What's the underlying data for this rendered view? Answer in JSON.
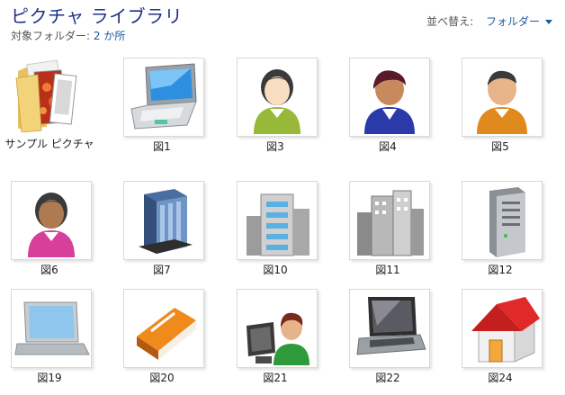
{
  "header": {
    "title": "ピクチャ ライブラリ",
    "target_label": "対象フォルダー:",
    "target_link": "2 か所",
    "sort_label": "並べ替え:",
    "sort_value": "フォルダー"
  },
  "items": [
    {
      "label": "サンプル ピクチャ",
      "icon": "folder-icon"
    },
    {
      "label": "図1",
      "icon": "laptop-icon"
    },
    {
      "label": "図3",
      "icon": "user-woman-icon"
    },
    {
      "label": "図4",
      "icon": "user-man-icon"
    },
    {
      "label": "図5",
      "icon": "user-orange-icon"
    },
    {
      "label": "図6",
      "icon": "user-woman-pink-icon"
    },
    {
      "label": "図7",
      "icon": "office-building-icon"
    },
    {
      "label": "図10",
      "icon": "buildings-icon"
    },
    {
      "label": "図11",
      "icon": "city-buildings-icon"
    },
    {
      "label": "図12",
      "icon": "server-icon"
    },
    {
      "label": "図19",
      "icon": "laptop-silver-icon"
    },
    {
      "label": "図20",
      "icon": "book-icon"
    },
    {
      "label": "図21",
      "icon": "user-computer-icon"
    },
    {
      "label": "図22",
      "icon": "notebook-icon"
    },
    {
      "label": "図24",
      "icon": "house-icon"
    }
  ]
}
